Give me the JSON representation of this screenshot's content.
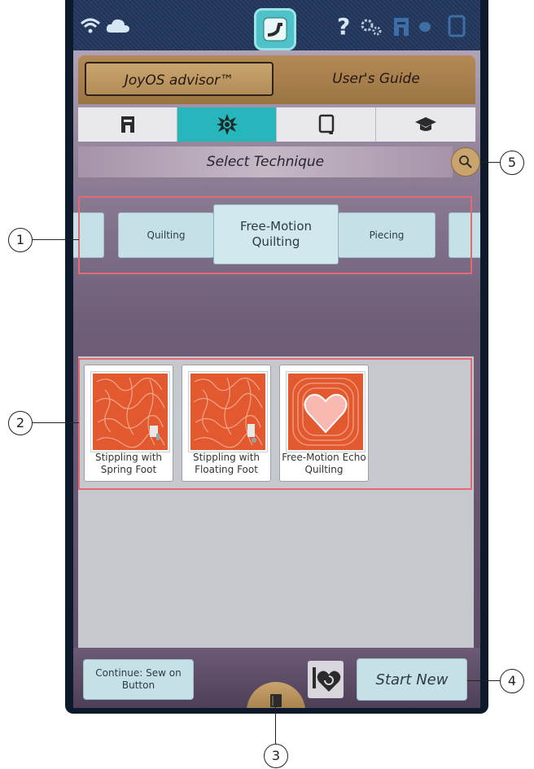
{
  "header": {
    "tabs": [
      {
        "label": "JoyOS advisor™",
        "selected": true
      },
      {
        "label": "User's Guide",
        "selected": false
      }
    ],
    "status_icons": [
      "wifi-icon",
      "cloud-icon",
      "home-icon",
      "help-icon",
      "gears-icon",
      "machine-icon",
      "thread-icon",
      "tablet-icon"
    ],
    "help_glyph": "?"
  },
  "icon_tabs": [
    {
      "icon": "machine-icon",
      "selected": false
    },
    {
      "icon": "star-technique-icon",
      "selected": true
    },
    {
      "icon": "project-icon",
      "selected": false
    },
    {
      "icon": "graduation-cap-icon",
      "selected": false
    }
  ],
  "technique": {
    "title": "Select Technique",
    "carousel": [
      "Quilting",
      "Free-Motion Quilting",
      "Piecing"
    ],
    "selected": "Free-Motion Quilting"
  },
  "cards": [
    {
      "label": "Stippling with Spring Foot"
    },
    {
      "label": "Stippling with Floating Foot"
    },
    {
      "label": "Free-Motion Echo Quilting"
    }
  ],
  "bottom": {
    "continue_label": "Continue: Sew on Button",
    "start_label": "Start New"
  },
  "callouts": [
    "1",
    "2",
    "3",
    "4",
    "5"
  ],
  "colors": {
    "accent": "#26b6bb",
    "wood": "#b38a55",
    "card_orange": "#e2592f",
    "chip": "#c6e0e7"
  }
}
